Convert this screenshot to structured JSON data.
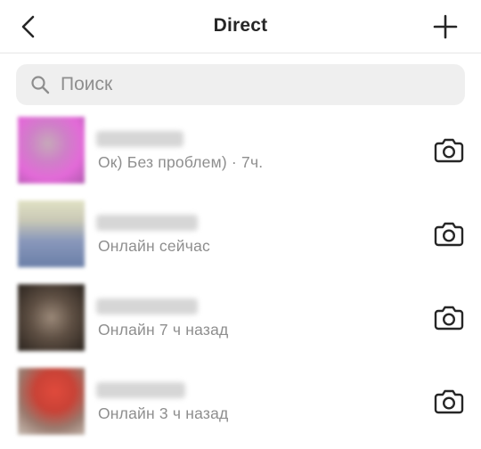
{
  "header": {
    "title": "Direct",
    "back_icon": "chevron-left-icon",
    "new_icon": "plus-icon"
  },
  "search": {
    "placeholder": "Поиск",
    "value": ""
  },
  "threads": [
    {
      "status": "Ок) Без проблем) · 7ч.",
      "avatar_color": "#d86ac9"
    },
    {
      "status": "Онлайн сейчас",
      "avatar_color": "#8e9cb8"
    },
    {
      "status": "Онлайн 7 ч назад",
      "avatar_color": "#5b4a3c"
    },
    {
      "status": "Онлайн 3 ч назад",
      "avatar_color": "#c9463a"
    }
  ]
}
